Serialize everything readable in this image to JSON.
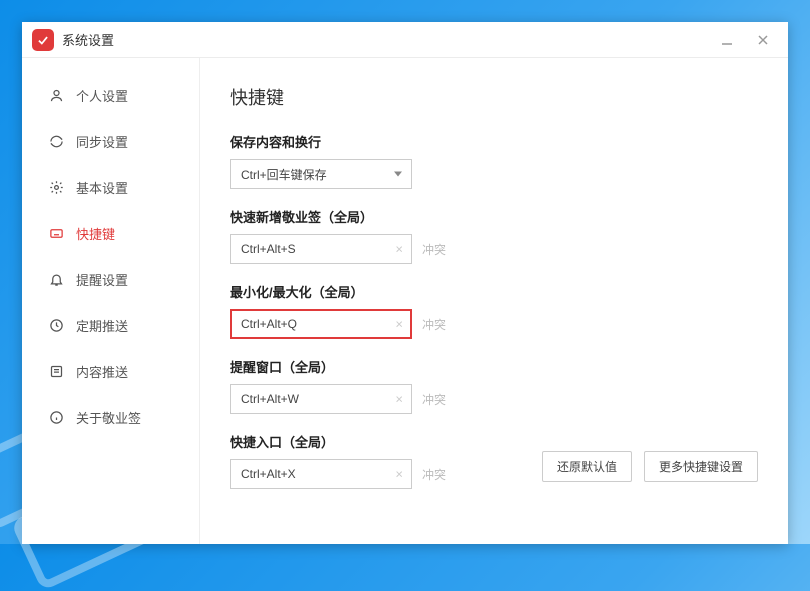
{
  "window": {
    "title": "系统设置"
  },
  "sidebar": {
    "items": [
      {
        "label": "个人设置"
      },
      {
        "label": "同步设置"
      },
      {
        "label": "基本设置"
      },
      {
        "label": "快捷键"
      },
      {
        "label": "提醒设置"
      },
      {
        "label": "定期推送"
      },
      {
        "label": "内容推送"
      },
      {
        "label": "关于敬业签"
      }
    ]
  },
  "main": {
    "title": "快捷键",
    "save": {
      "label": "保存内容和换行",
      "value": "Ctrl+回车键保存"
    },
    "quickAdd": {
      "label": "快速新增敬业签（全局）",
      "value": "Ctrl+Alt+S",
      "status": "冲突"
    },
    "minMax": {
      "label": "最小化/最大化（全局）",
      "value": "Ctrl+Alt+Q",
      "status": "冲突"
    },
    "remind": {
      "label": "提醒窗口（全局）",
      "value": "Ctrl+Alt+W",
      "status": "冲突"
    },
    "entry": {
      "label": "快捷入口（全局）",
      "value": "Ctrl+Alt+X",
      "status": "冲突"
    },
    "restore": "还原默认值",
    "more": "更多快捷键设置"
  }
}
